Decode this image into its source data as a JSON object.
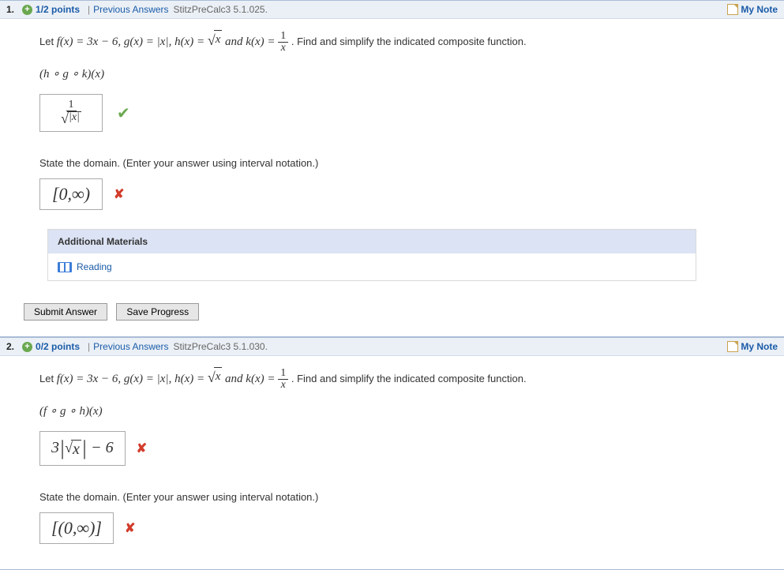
{
  "questions": [
    {
      "number": "1.",
      "points": "1/2 points",
      "prev_label": "Previous Answers",
      "topic": "StitzPreCalc3 5.1.025.",
      "my_notes": "My Note",
      "let_prefix": "Let ",
      "fdef": "f(x) = 3x − 6, g(x) = |x|, h(x) = ",
      "and": " and ",
      "kdef": "k(x) = ",
      "instruction": ".  Find and simplify the indicated composite function.",
      "composite": "(h ∘ g ∘ k)(x)",
      "answer1_num": "1",
      "answer1_rad": "|x|",
      "answer1_status": "correct",
      "domain_prompt": "State the domain. (Enter your answer using interval notation.)",
      "answer2": "[0,∞)",
      "answer2_status": "incorrect",
      "materials_title": "Additional Materials",
      "reading": "Reading",
      "submit": "Submit Answer",
      "save": "Save Progress"
    },
    {
      "number": "2.",
      "points": "0/2 points",
      "prev_label": "Previous Answers",
      "topic": "StitzPreCalc3 5.1.030.",
      "my_notes": "My Note",
      "let_prefix": "Let ",
      "fdef": "f(x) = 3x − 6, g(x) = |x|, h(x) = ",
      "and": " and ",
      "kdef": "k(x) = ",
      "instruction": ".  Find and simplify the indicated composite function.",
      "composite": "(f ∘ g ∘ h)(x)",
      "answer1_abs": "3|√x| − 6",
      "answer1_status": "incorrect",
      "domain_prompt": "State the domain. (Enter your answer using interval notation.)",
      "answer2": "[(0,∞)]",
      "answer2_status": "incorrect"
    }
  ]
}
